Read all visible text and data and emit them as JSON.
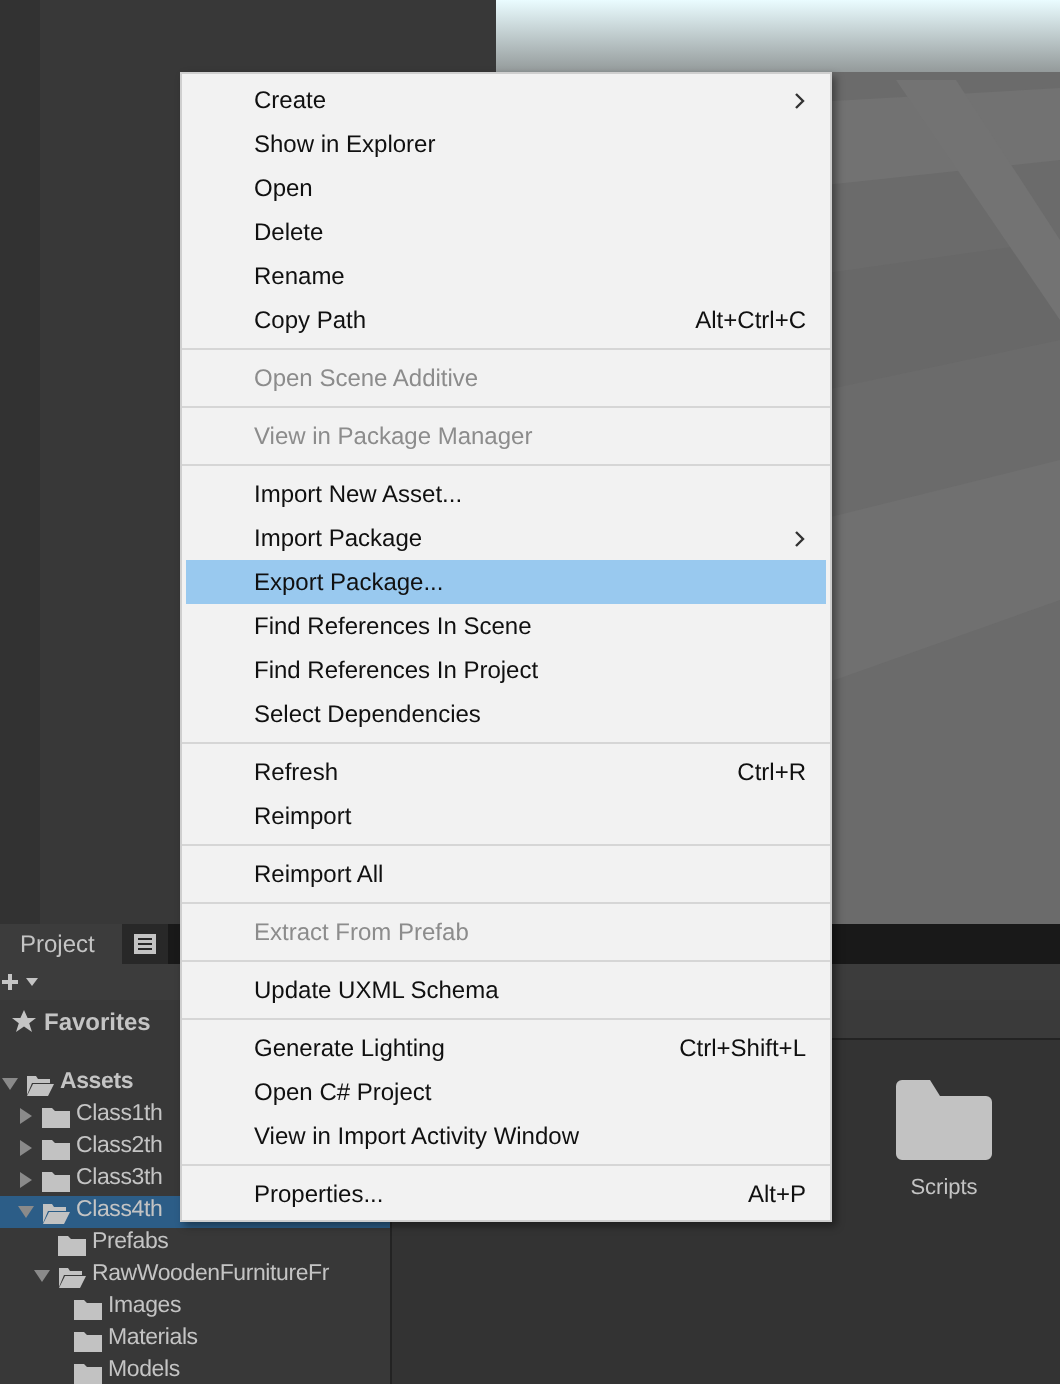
{
  "project_panel": {
    "tabs": [
      {
        "label": "Project",
        "selected": true
      }
    ],
    "favorites": "Favorites",
    "tree": [
      {
        "label": "Assets",
        "expanded": true,
        "children": [
          {
            "label": "Class1th",
            "expanded": false,
            "selected": false
          },
          {
            "label": "Class2th",
            "expanded": false,
            "selected": false
          },
          {
            "label": "Class3th",
            "expanded": false,
            "selected": false
          },
          {
            "label": "Class4th",
            "expanded": true,
            "selected": true,
            "children": [
              {
                "label": "Prefabs",
                "selected": false
              },
              {
                "label": "RawWoodenFurnitureFr",
                "expanded": true,
                "selected": false,
                "children": [
                  {
                    "label": "Images",
                    "selected": false
                  },
                  {
                    "label": "Materials",
                    "selected": false
                  },
                  {
                    "label": "Models",
                    "selected": false
                  }
                ]
              }
            ]
          }
        ]
      }
    ],
    "grid_items": [
      {
        "label": "Scripts"
      }
    ]
  },
  "context_menu": [
    {
      "kind": "item",
      "label": "Create",
      "submenu": true,
      "disabled": false,
      "selected": false
    },
    {
      "kind": "item",
      "label": "Show in Explorer",
      "disabled": false,
      "selected": false
    },
    {
      "kind": "item",
      "label": "Open",
      "disabled": false,
      "selected": false
    },
    {
      "kind": "item",
      "label": "Delete",
      "disabled": false,
      "selected": false
    },
    {
      "kind": "item",
      "label": "Rename",
      "disabled": false,
      "selected": false
    },
    {
      "kind": "item",
      "label": "Copy Path",
      "shortcut": "Alt+Ctrl+C",
      "disabled": false,
      "selected": false
    },
    {
      "kind": "separator"
    },
    {
      "kind": "item",
      "label": "Open Scene Additive",
      "disabled": true,
      "selected": false
    },
    {
      "kind": "separator"
    },
    {
      "kind": "item",
      "label": "View in Package Manager",
      "disabled": true,
      "selected": false
    },
    {
      "kind": "separator"
    },
    {
      "kind": "item",
      "label": "Import New Asset...",
      "disabled": false,
      "selected": false
    },
    {
      "kind": "item",
      "label": "Import Package",
      "submenu": true,
      "disabled": false,
      "selected": false
    },
    {
      "kind": "item",
      "label": "Export Package...",
      "disabled": false,
      "selected": true
    },
    {
      "kind": "item",
      "label": "Find References In Scene",
      "disabled": false,
      "selected": false
    },
    {
      "kind": "item",
      "label": "Find References In Project",
      "disabled": false,
      "selected": false
    },
    {
      "kind": "item",
      "label": "Select Dependencies",
      "disabled": false,
      "selected": false
    },
    {
      "kind": "separator"
    },
    {
      "kind": "item",
      "label": "Refresh",
      "shortcut": "Ctrl+R",
      "disabled": false,
      "selected": false
    },
    {
      "kind": "item",
      "label": "Reimport",
      "disabled": false,
      "selected": false
    },
    {
      "kind": "separator"
    },
    {
      "kind": "item",
      "label": "Reimport All",
      "disabled": false,
      "selected": false
    },
    {
      "kind": "separator"
    },
    {
      "kind": "item",
      "label": "Extract From Prefab",
      "disabled": true,
      "selected": false
    },
    {
      "kind": "separator"
    },
    {
      "kind": "item",
      "label": "Update UXML Schema",
      "disabled": false,
      "selected": false
    },
    {
      "kind": "separator"
    },
    {
      "kind": "item",
      "label": "Generate Lighting",
      "shortcut": "Ctrl+Shift+L",
      "disabled": false,
      "selected": false
    },
    {
      "kind": "item",
      "label": "Open C# Project",
      "disabled": false,
      "selected": false
    },
    {
      "kind": "item",
      "label": "View in Import Activity Window",
      "disabled": false,
      "selected": false
    },
    {
      "kind": "separator"
    },
    {
      "kind": "item",
      "label": "Properties...",
      "shortcut": "Alt+P",
      "disabled": false,
      "selected": false
    }
  ]
}
